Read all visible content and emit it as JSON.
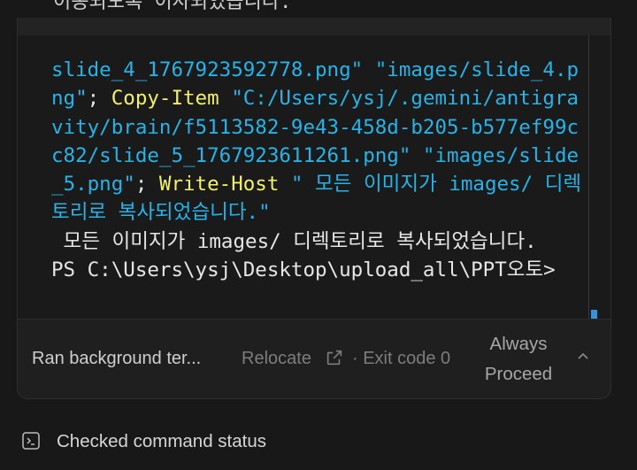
{
  "top_fragment": "이동되도록 이사되었습니다.",
  "terminal": {
    "segments": [
      {
        "cls": "c-str",
        "text": "slide_4_1767923592778.png\" \"images/slide_4.png\""
      },
      {
        "cls": "c-plain",
        "text": "; "
      },
      {
        "cls": "c-cmd",
        "text": "Copy-Item"
      },
      {
        "cls": "c-str",
        "text": " \"C:/Users/ysj/.gemini/antigravity/brain/f5113582-9e43-458d-b205-b577ef99cc82/slide_5_1767923611261.png\" \"images/slide_5.png\""
      },
      {
        "cls": "c-plain",
        "text": "; "
      },
      {
        "cls": "c-cmd",
        "text": "Write-Host"
      },
      {
        "cls": "c-str",
        "text": " \" 모든 이미지가 images/ 디렉토리로 복사되었습니다.\""
      },
      {
        "cls": "c-plain",
        "text": "\n 모든 이미지가 images/ 디렉토리로 복사되었습니다.\nPS C:\\Users\\ysj\\Desktop\\upload_all\\PPT오토>"
      }
    ]
  },
  "status": {
    "label": "Ran background ter...",
    "relocate": "Relocate",
    "exit_code": "· Exit code 0",
    "always_proceed": "Always Proceed"
  },
  "checked": {
    "label": "Checked command status"
  },
  "colors": {
    "string": "#26b3e8",
    "command": "#f3f06b",
    "text": "#e6e6e6",
    "accent": "#3e8ed0"
  },
  "icons": {
    "relocate": "external-link-icon",
    "collapse": "chevron-up-icon",
    "terminal": "terminal-icon"
  }
}
